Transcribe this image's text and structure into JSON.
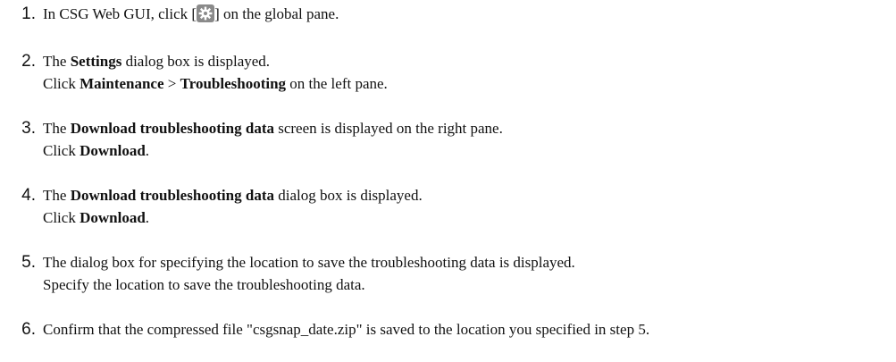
{
  "steps": [
    {
      "num": "1.",
      "line1": {
        "pre": "In CSG Web GUI, click [",
        "post": "] on the global pane."
      }
    },
    {
      "num": "2.",
      "line1": {
        "pre": "The ",
        "bold": "Settings",
        "post": " dialog box is displayed."
      },
      "line2": {
        "pre": "Click ",
        "bold1": "Maintenance",
        "mid": " > ",
        "bold2": "Troubleshooting",
        "post": " on the left pane."
      }
    },
    {
      "num": "3.",
      "line1": {
        "pre": "The ",
        "bold": "Download troubleshooting data",
        "post": " screen is displayed on the right pane."
      },
      "line2": {
        "pre": "Click ",
        "bold": "Download",
        "post": "."
      }
    },
    {
      "num": "4.",
      "line1": {
        "pre": "The ",
        "bold": "Download troubleshooting data",
        "post": " dialog box is displayed."
      },
      "line2": {
        "pre": "Click ",
        "bold": "Download",
        "post": "."
      }
    },
    {
      "num": "5.",
      "line1": {
        "text": "The dialog box for specifying the location to save the troubleshooting data is displayed."
      },
      "line2": {
        "text": "Specify the location to save the troubleshooting data."
      }
    },
    {
      "num": "6.",
      "line1": {
        "text": "Confirm that the compressed file \"csgsnap_date.zip\" is saved to the location you specified in step 5."
      }
    }
  ],
  "icons": {
    "settings": "gear-icon"
  }
}
